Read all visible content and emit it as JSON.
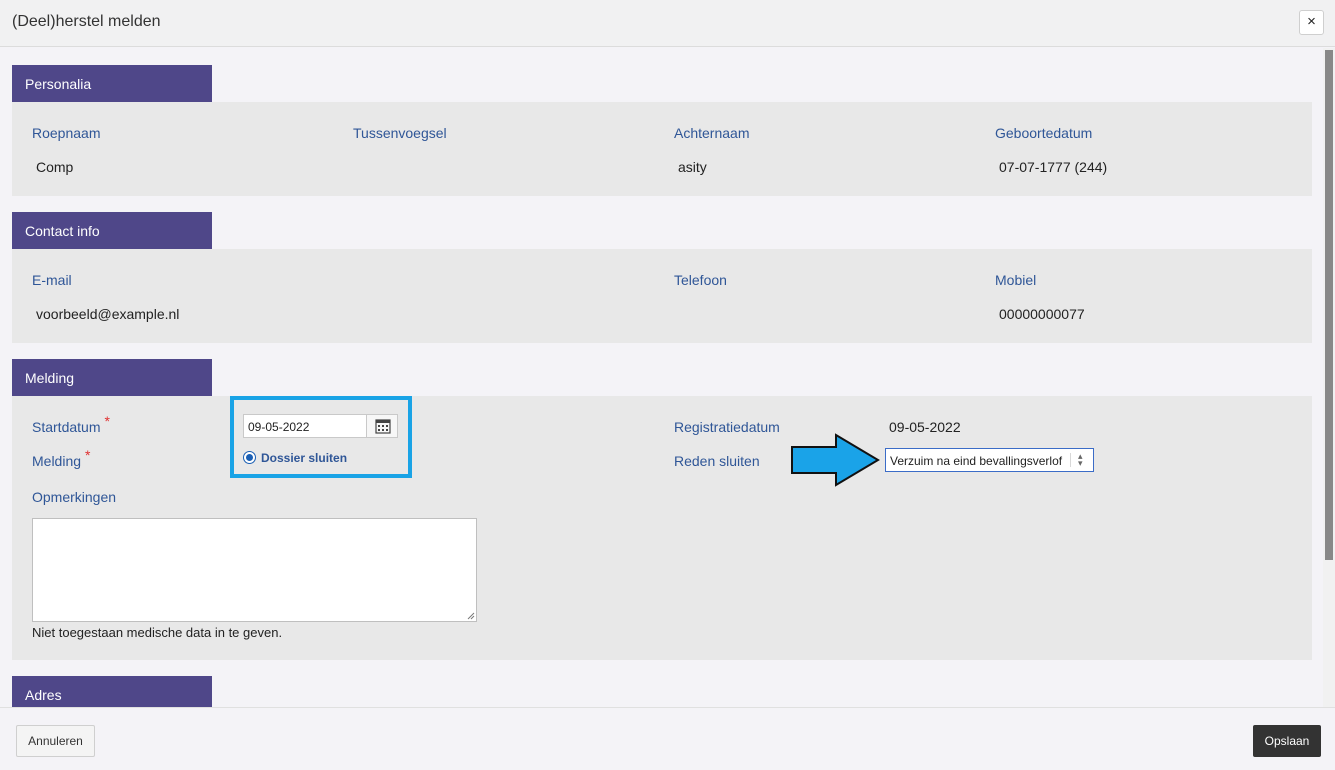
{
  "dialog": {
    "title": "(Deel)herstel melden",
    "close_symbol": "×"
  },
  "sections": {
    "personalia": {
      "title": "Personalia",
      "roepnaam_label": "Roepnaam",
      "roepnaam_value": "Comp",
      "tussenvoegsel_label": "Tussenvoegsel",
      "tussenvoegsel_value": "",
      "achternaam_label": "Achternaam",
      "achternaam_value": "asity",
      "geboortedatum_label": "Geboortedatum",
      "geboortedatum_value": "07-07-1777 (244)"
    },
    "contact": {
      "title": "Contact info",
      "email_label": "E-mail",
      "email_value": "voorbeeld@example.nl",
      "telefoon_label": "Telefoon",
      "telefoon_value": "",
      "mobiel_label": "Mobiel",
      "mobiel_value": "00000000077"
    },
    "melding": {
      "title": "Melding",
      "startdatum_label": "Startdatum",
      "startdatum_value": "09-05-2022",
      "melding_label": "Melding",
      "required_mark": "*",
      "dossier_option": "Dossier sluiten",
      "registratiedatum_label": "Registratiedatum",
      "registratiedatum_value": "09-05-2022",
      "reden_label": "Reden sluiten",
      "reden_value": "Verzuim na eind bevallingsverlof",
      "opmerkingen_label": "Opmerkingen",
      "opmerkingen_value": "",
      "hint": "Niet toegestaan medische data in te geven."
    },
    "adres": {
      "title": "Adres"
    }
  },
  "footer": {
    "cancel_label": "Annuleren",
    "save_label": "Opslaan"
  },
  "colors": {
    "section_tab": "#4f4789",
    "label": "#2f5697",
    "highlight": "#19a3e6",
    "arrow": "#1aa3e8"
  }
}
